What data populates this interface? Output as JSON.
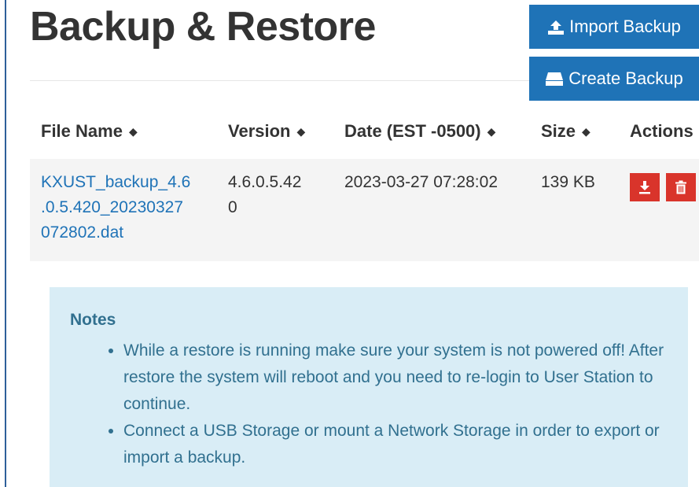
{
  "header": {
    "title": "Backup & Restore",
    "import_label": "Import Backup",
    "create_label": "Create Backup"
  },
  "table": {
    "columns": [
      "File Name",
      "Version",
      "Date (EST -0500)",
      "Size",
      "Actions"
    ],
    "sort_icon": "sort-icon",
    "rows": [
      {
        "file_name_lines": [
          "KXUST_backup_4.6",
          ".0.5.420_20230327",
          "072802.dat"
        ],
        "version_lines": [
          "4.6.0.5.42",
          "0"
        ],
        "date": "2023-03-27 07:28:02",
        "size": "139 KB",
        "actions": [
          "download-icon",
          "trash-icon"
        ]
      }
    ]
  },
  "notes": {
    "title": "Notes",
    "items": [
      "While a restore is running make sure your system is not powered off! After restore the system will reboot and you need to re-login to User Station to continue.",
      "Connect a USB Storage or mount a Network Storage in order to export or import a backup."
    ]
  },
  "colors": {
    "primary": "#1f73b7",
    "danger": "#d9342b",
    "info_bg": "#d9edf6",
    "info_text": "#31708f",
    "row_bg": "#f4f4f4"
  }
}
